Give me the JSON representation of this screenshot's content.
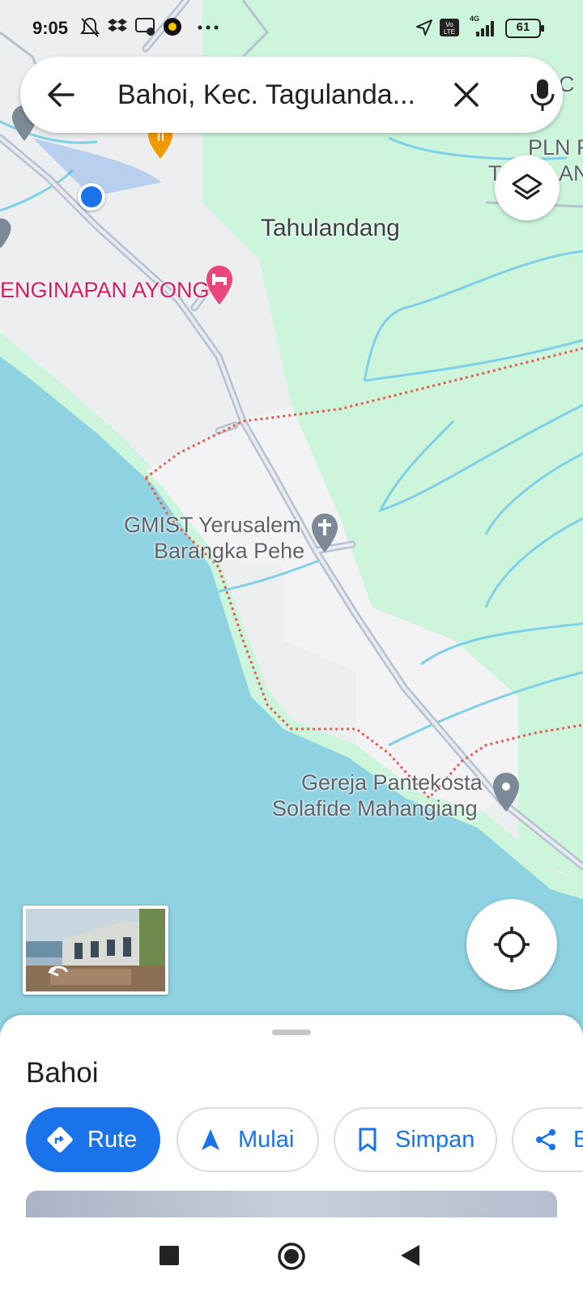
{
  "status_bar": {
    "time": "9:05",
    "battery": "61",
    "network": "4G",
    "icons": [
      "bell-off-icon",
      "dropbox-icon",
      "wifi-calling-icon",
      "app-badge-icon",
      "more-dots-icon",
      "location-arrow-icon",
      "volte-icon",
      "signal-icon",
      "battery-icon"
    ]
  },
  "search": {
    "query": "Bahoi, Kec. Tagulanda...",
    "back_icon": "arrow-left-icon",
    "clear_icon": "close-icon",
    "mic_icon": "microphone-icon"
  },
  "map": {
    "place_label": "Tahulandang",
    "hotel_label": "ENGINAPAN AYONG",
    "poi_church1_line1": "GMIST Yerusalem",
    "poi_church1_line2": "Barangka Pehe",
    "poi_church2_line1": "Gereja Pantekosta",
    "poi_church2_line2": "Solafide Mahangiang",
    "partial_label_line1": "PLN R",
    "partial_label_line2": "T",
    "partial_label_line2b": "AN",
    "partial_label_c": "C",
    "colors": {
      "sea": "#8fd3e3",
      "land": "#edeef0",
      "forest": "#cdf5dc",
      "road": "#c4ccd8",
      "boundary": "#e35d4f",
      "accent": "#1a73e8"
    }
  },
  "sheet": {
    "title": "Bahoi",
    "buttons": [
      {
        "label": "Rute",
        "icon": "directions-icon"
      },
      {
        "label": "Mulai",
        "icon": "navigation-arrow-icon"
      },
      {
        "label": "Simpan",
        "icon": "bookmark-icon"
      },
      {
        "label": "B",
        "icon": "share-icon"
      }
    ]
  },
  "nav": {
    "recents_icon": "square-icon",
    "home_icon": "circle-icon",
    "back_icon": "triangle-back-icon"
  }
}
